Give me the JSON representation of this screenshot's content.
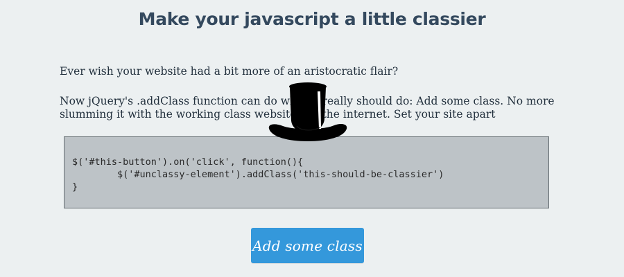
{
  "header": {
    "title": "Make your javascript a little classier"
  },
  "intro": {
    "question": "Ever wish your website had a bit more of an aristocratic flair?",
    "description": "Now jQuery's .addClass function can do what it really should do: Add some class. No more slumming it with the working class websites on the internet. Set your site apart"
  },
  "code_sample": {
    "lines": [
      "$('#this-button').on('click', function(){",
      "        $('#unclassy-element').addClass('this-should-be-classier')",
      "}"
    ]
  },
  "action": {
    "button_label": "Add some class"
  },
  "decoration": {
    "hat_icon": "top-hat-icon"
  },
  "colors": {
    "background": "#ecf0f1",
    "heading": "#34495e",
    "code_background": "#bdc3c7",
    "button": "#3498db",
    "button_text": "#ffffff"
  }
}
